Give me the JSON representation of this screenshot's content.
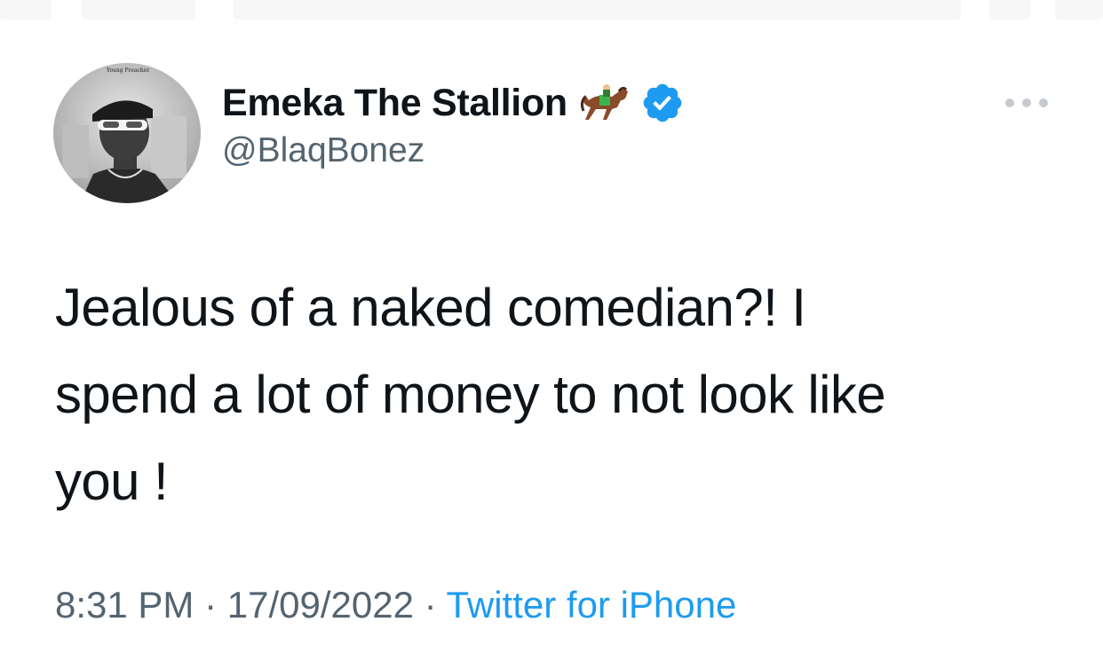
{
  "tweet": {
    "avatar": {
      "caption": "Young Preacher"
    },
    "author": {
      "display_name": "Emeka The Stallion",
      "handle": "@BlaqBonez",
      "verified": true
    },
    "icons": {
      "horse": "horse-racing-icon",
      "verified": "verified-badge-icon",
      "more": "more-options-icon"
    },
    "colors": {
      "accent": "#1d9bf0",
      "text_primary": "#0f1419",
      "text_secondary": "#536471"
    },
    "text_lines": [
      "Jealous of a naked comedian?! I",
      "spend a lot of money to not look like",
      "you !"
    ],
    "meta": {
      "time": "8:31 PM",
      "separator": " · ",
      "date": "17/09/2022",
      "source": "Twitter for iPhone"
    }
  }
}
